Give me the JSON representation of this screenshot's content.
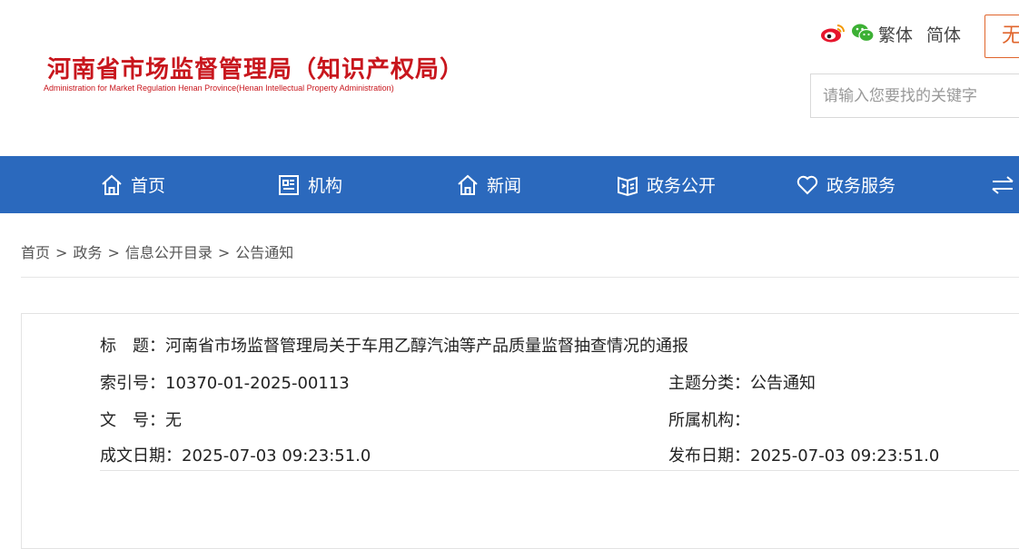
{
  "header": {
    "site_title": "河南省市场监督管理局（知识产权局）",
    "site_subtitle": "Administration for Market Regulation Henan Province(Henan Intellectual Property Administration)",
    "social_icons": [
      "weibo-icon",
      "wechat-icon"
    ],
    "lang_traditional": "繁体",
    "lang_simplified": "简体",
    "accessibility_label": "无",
    "search_placeholder": "请输入您要找的关键字",
    "brand_color": "#c8161d",
    "accent_color": "#e0652c"
  },
  "nav": {
    "background": "#2b69bd",
    "items": [
      {
        "label": "首页",
        "icon": "home-icon"
      },
      {
        "label": "机构",
        "icon": "institution-icon"
      },
      {
        "label": "新闻",
        "icon": "news-icon"
      },
      {
        "label": "政务公开",
        "icon": "open-government-icon"
      },
      {
        "label": "政务服务",
        "icon": "heart-icon"
      },
      {
        "label": "",
        "icon": "interaction-arrows-icon"
      }
    ]
  },
  "breadcrumb": {
    "items": [
      "首页",
      "政务",
      "信息公开目录",
      "公告通知"
    ],
    "separator": ">"
  },
  "info": {
    "title_label": "标　题：",
    "title_value": "河南省市场监督管理局关于车用乙醇汽油等产品质量监督抽查情况的通报",
    "index_label": "索引号：",
    "index_value": "10370-01-2025-00113",
    "category_label": "主题分类：",
    "category_value": "公告通知",
    "docno_label": "文　号：",
    "docno_value": "无",
    "org_label": "所属机构：",
    "org_value": "",
    "created_label": "成文日期：",
    "created_value": "2025-07-03 09:23:51.0",
    "published_label": "发布日期：",
    "published_value": "2025-07-03 09:23:51.0"
  }
}
